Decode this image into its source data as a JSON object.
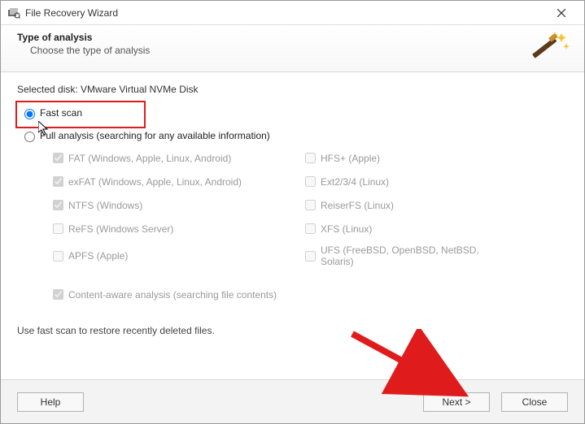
{
  "window": {
    "title": "File Recovery Wizard",
    "close_tooltip": "Close"
  },
  "header": {
    "heading": "Type of analysis",
    "subheading": "Choose the type of analysis"
  },
  "selected_disk_label": "Selected disk: VMware Virtual NVMe Disk",
  "options": {
    "fast_scan": {
      "label": "Fast scan",
      "selected": true
    },
    "full_analysis": {
      "label": "Full analysis (searching for any available information)",
      "selected": false
    }
  },
  "filesystems": {
    "left": [
      {
        "label": "FAT (Windows, Apple, Linux, Android)",
        "checked": true
      },
      {
        "label": "exFAT (Windows, Apple, Linux, Android)",
        "checked": true
      },
      {
        "label": "NTFS (Windows)",
        "checked": true
      },
      {
        "label": "ReFS (Windows Server)",
        "checked": false
      },
      {
        "label": "APFS (Apple)",
        "checked": false
      }
    ],
    "right": [
      {
        "label": "HFS+ (Apple)",
        "checked": false
      },
      {
        "label": "Ext2/3/4 (Linux)",
        "checked": false
      },
      {
        "label": "ReiserFS (Linux)",
        "checked": false
      },
      {
        "label": "XFS (Linux)",
        "checked": false
      },
      {
        "label": "UFS (FreeBSD, OpenBSD, NetBSD, Solaris)",
        "checked": false
      }
    ]
  },
  "content_aware": {
    "label": "Content-aware analysis (searching file contents)",
    "checked": true
  },
  "hints": {
    "fast": "Use fast scan to restore recently deleted files."
  },
  "buttons": {
    "help": "Help",
    "next": "Next >",
    "close": "Close"
  }
}
